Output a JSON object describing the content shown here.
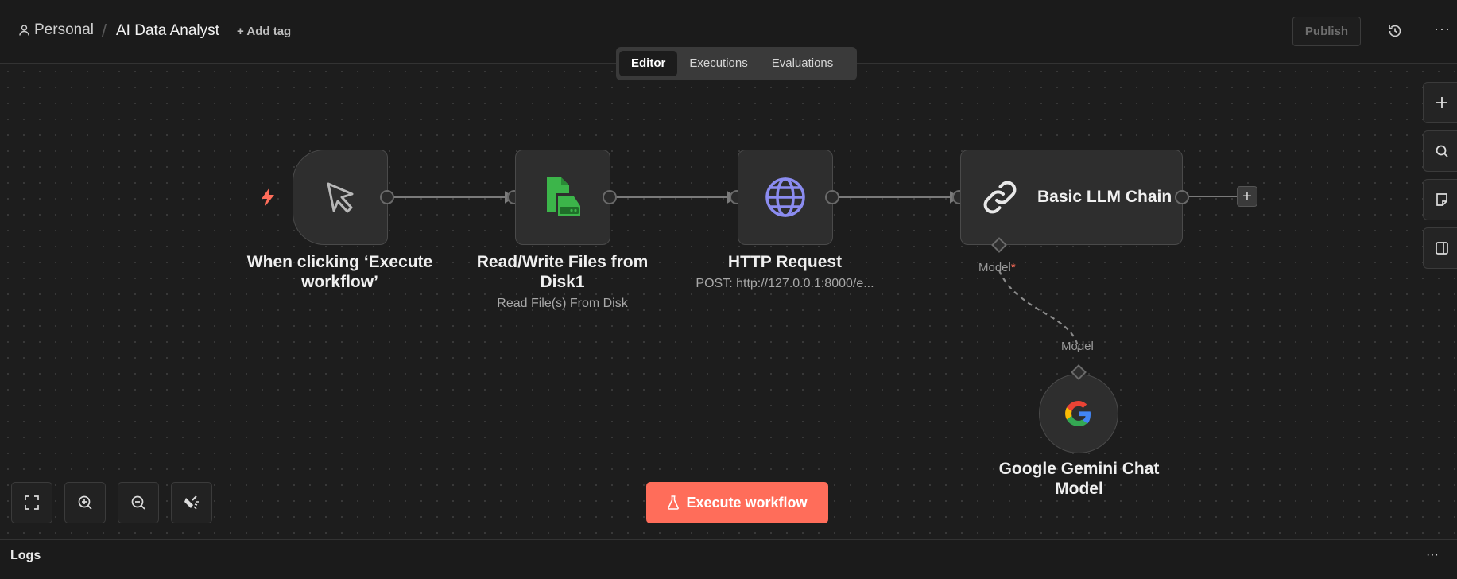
{
  "header": {
    "workspace": "Personal",
    "separator": "/",
    "workflow_title": "AI Data Analyst",
    "add_tag": "+ Add tag",
    "publish": "Publish",
    "more": "···"
  },
  "tabs": [
    {
      "label": "Editor",
      "active": true
    },
    {
      "label": "Executions",
      "active": false
    },
    {
      "label": "Evaluations",
      "active": false
    }
  ],
  "nodes": {
    "trigger": {
      "title": "When clicking ‘Execute workflow’",
      "icon": "cursor-icon"
    },
    "files": {
      "title": "Read/Write Files from Disk1",
      "subtitle": "Read File(s) From Disk",
      "icon": "file-disk-icon",
      "icon_color": "#3cb54a"
    },
    "http": {
      "title": "HTTP Request",
      "subtitle": "POST: http://127.0.0.1:8000/e...",
      "icon": "globe-icon",
      "icon_color": "#8b8cf0"
    },
    "llm": {
      "title": "Basic LLM Chain",
      "icon": "link-chain-icon",
      "port_label": "Model",
      "port_required": "*"
    },
    "gemini": {
      "title": "Google Gemini Chat Model",
      "icon": "google-icon",
      "port_label": "Model"
    }
  },
  "canvas_controls": [
    "fit-view-icon",
    "zoom-in-icon",
    "zoom-out-icon",
    "tidy-up-icon"
  ],
  "side_actions": [
    "plus-icon",
    "search-icon",
    "sticky-note-icon",
    "panel-icon"
  ],
  "execute_button": "Execute workflow",
  "logs": {
    "title": "Logs",
    "more": "···"
  },
  "colors": {
    "accent": "#ff6d5a",
    "background": "#1d1d1d",
    "node": "#2e2e2e"
  }
}
